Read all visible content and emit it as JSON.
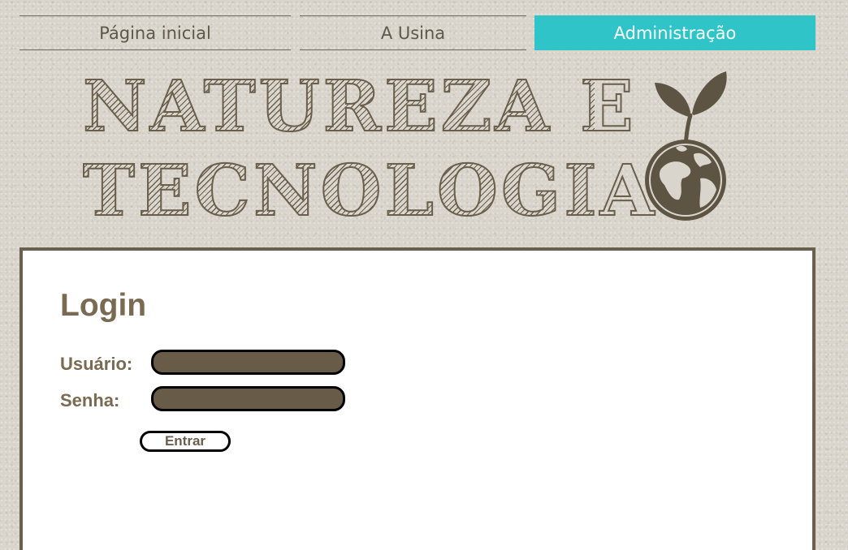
{
  "nav": {
    "items": [
      {
        "label": "Página inicial",
        "active": false
      },
      {
        "label": "A Usina",
        "active": false
      },
      {
        "label": "Administração",
        "active": true
      }
    ],
    "active_color": "#2fc5c8"
  },
  "banner": {
    "line1": "NATUREZA E",
    "line2": "TECNOLOGIA",
    "logo_icon": "sprout-globe-icon",
    "color": "#6a5e4c"
  },
  "login": {
    "title": "Login",
    "user_label": "Usuário:",
    "user_value": "",
    "password_label": "Senha:",
    "password_value": "",
    "submit_label": "Entrar"
  },
  "theme": {
    "brown": "#6b5f4d",
    "input_fill": "#685b48",
    "text_brown": "#7a6a52"
  }
}
